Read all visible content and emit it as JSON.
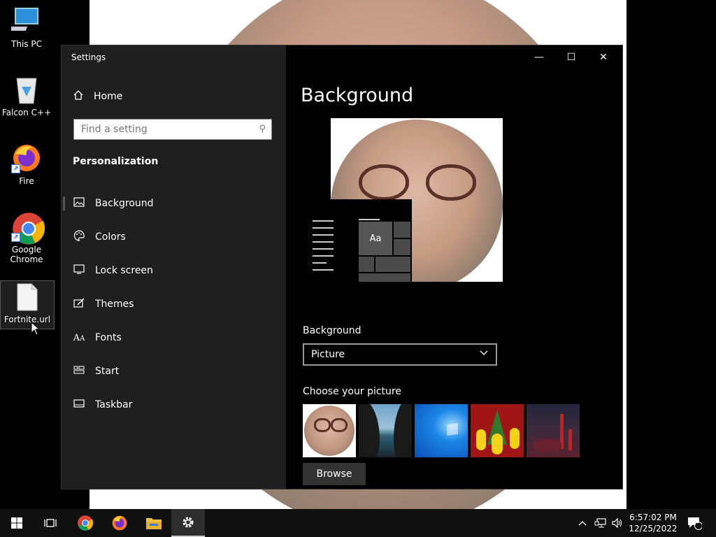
{
  "desktop": {
    "icons": [
      {
        "label": "This PC",
        "icon": "computer-icon"
      },
      {
        "label": "Falcon C++",
        "icon": "recycle-bin-icon"
      },
      {
        "label": "Fire",
        "icon": "firefox-icon"
      },
      {
        "label": "Google Chrome",
        "icon": "chrome-icon"
      },
      {
        "label": "Fortnite.url",
        "icon": "file-icon",
        "selected": true
      }
    ]
  },
  "window": {
    "title": "Settings",
    "controls": {
      "minimize": "—",
      "maximize": "☐",
      "close": "✕"
    }
  },
  "nav": {
    "home_label": "Home",
    "search_placeholder": "Find a setting",
    "section_title": "Personalization",
    "items": [
      {
        "label": "Background",
        "icon": "picture-icon",
        "active": true
      },
      {
        "label": "Colors",
        "icon": "palette-icon"
      },
      {
        "label": "Lock screen",
        "icon": "lock-screen-icon"
      },
      {
        "label": "Themes",
        "icon": "themes-icon"
      },
      {
        "label": "Fonts",
        "icon": "fonts-icon"
      },
      {
        "label": "Start",
        "icon": "start-icon"
      },
      {
        "label": "Taskbar",
        "icon": "taskbar-icon"
      }
    ]
  },
  "main": {
    "heading": "Background",
    "preview_tile_text": "Aa",
    "background_label": "Background",
    "background_value": "Picture",
    "choose_label": "Choose your picture",
    "browse_label": "Browse",
    "thumbnails": [
      "face-photo",
      "beach-cave",
      "windows-blue",
      "christmas-minions",
      "christmas-candles"
    ]
  },
  "taskbar": {
    "apps": [
      "start-icon",
      "task-view-icon",
      "chrome-icon",
      "firefox-icon",
      "file-explorer-icon",
      "settings-icon"
    ],
    "time": "6:57:02 PM",
    "date": "12/25/2022",
    "notification_count": "1"
  },
  "colors": {
    "nav_bg": "#1f1f1f",
    "content_bg": "#000000",
    "accent": "#0078d7"
  }
}
